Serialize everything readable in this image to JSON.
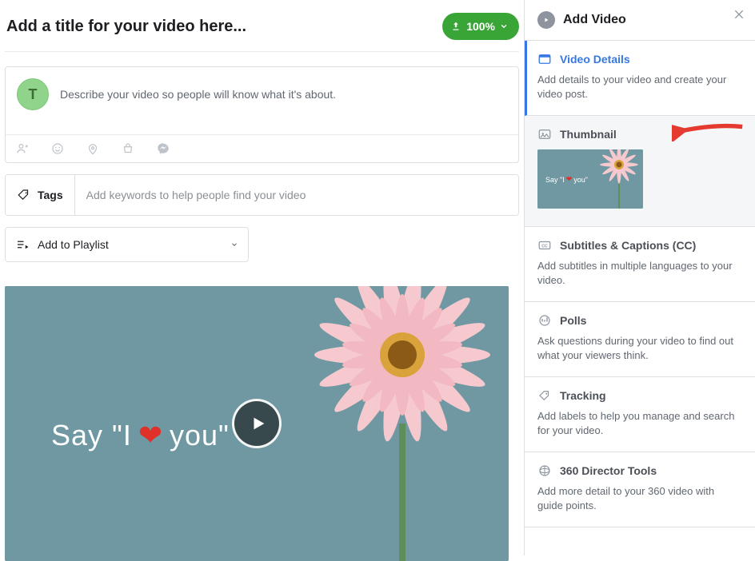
{
  "main": {
    "title_placeholder": "Add a title for your video here...",
    "upload_progress": "100%",
    "avatar_initial": "T",
    "description_placeholder": "Describe your video so people will know what it's about.",
    "tags_label": "Tags",
    "tags_placeholder": "Add keywords to help people find your video",
    "playlist_label": "Add to Playlist",
    "preview_text_left": "Say \"I",
    "preview_text_right": "you\"",
    "heart": "❤"
  },
  "side": {
    "header": "Add Video",
    "sections": {
      "details": {
        "title": "Video Details",
        "desc": "Add details to your video and create your video post."
      },
      "thumbnail": {
        "title": "Thumbnail",
        "mini_left": "Say \"I",
        "mini_right": "you\"",
        "heart": "❤"
      },
      "cc": {
        "title": "Subtitles & Captions (CC)",
        "desc": "Add subtitles in multiple languages to your video."
      },
      "polls": {
        "title": "Polls",
        "desc": "Ask questions during your video to find out what your viewers think."
      },
      "tracking": {
        "title": "Tracking",
        "desc": "Add labels to help you manage and search for your video."
      },
      "director": {
        "title": "360 Director Tools",
        "desc": "Add more detail to your 360 video with guide points."
      }
    }
  }
}
